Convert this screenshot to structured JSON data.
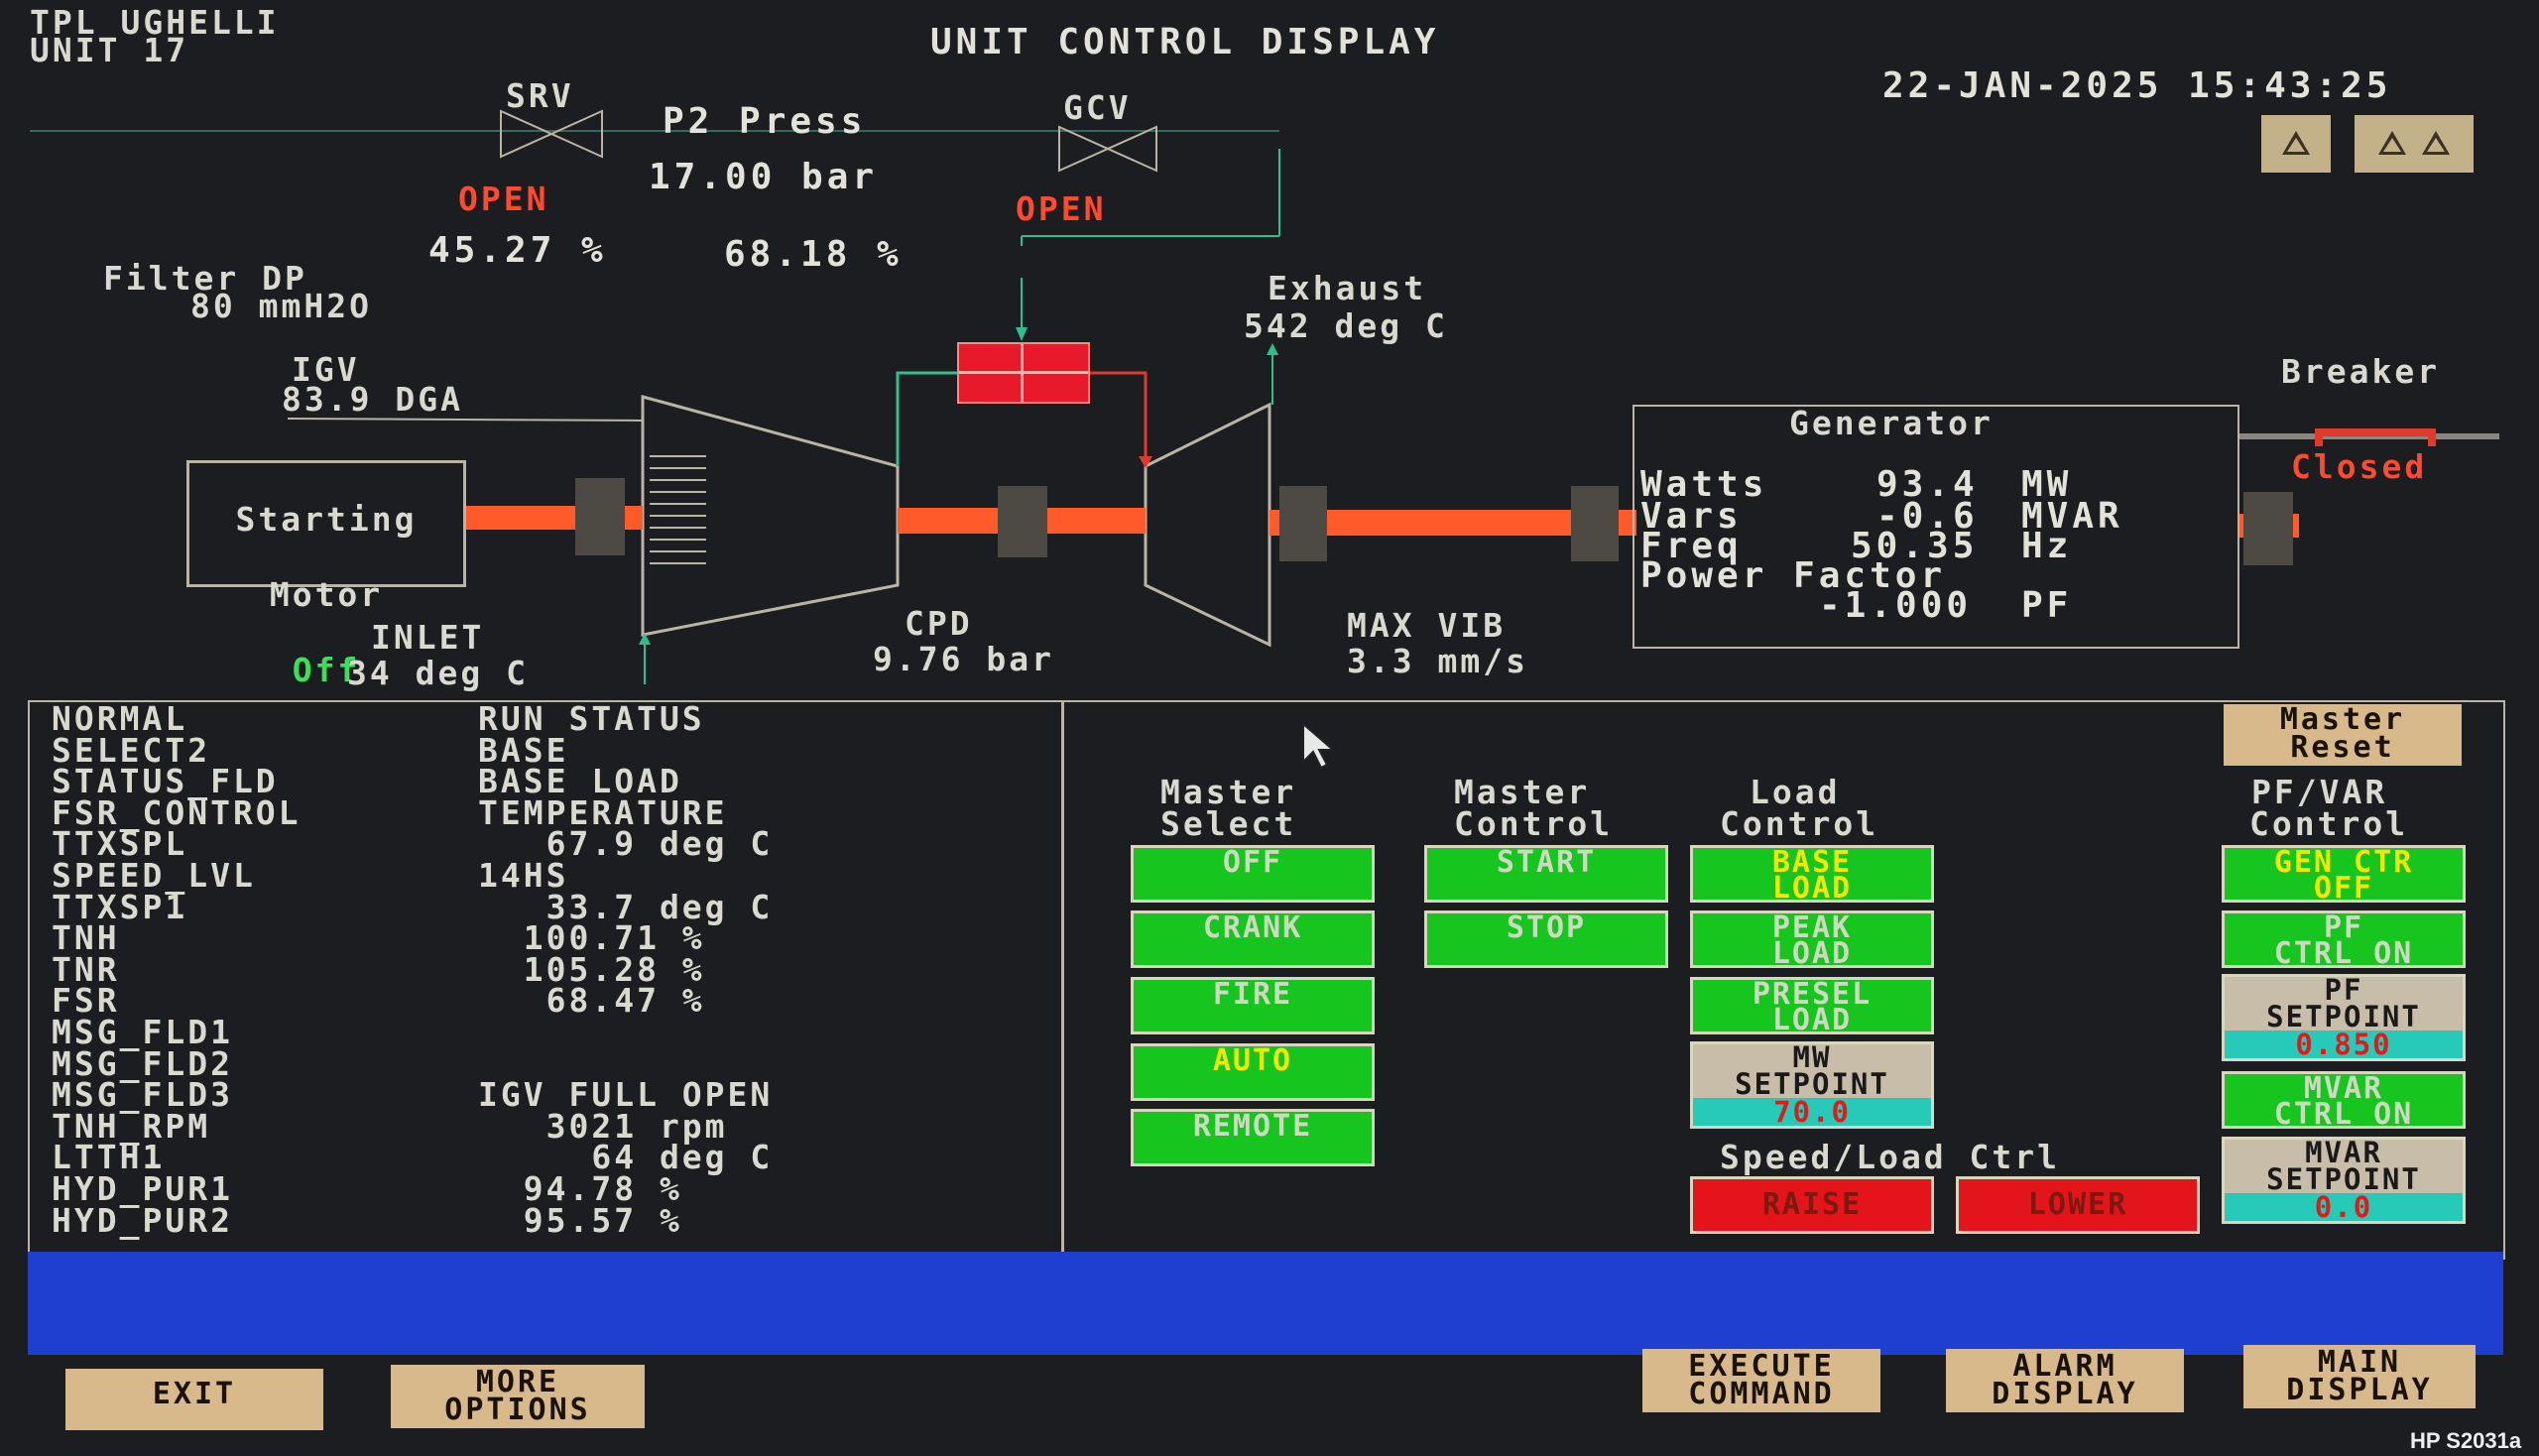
{
  "header": {
    "site": "TPL UGHELLI",
    "unit": "UNIT 17",
    "title": "UNIT CONTROL DISPLAY",
    "datetime": "22-JAN-2025 15:43:25"
  },
  "process": {
    "srv_label": "SRV",
    "srv_state": "OPEN",
    "srv_pct": "45.27 %",
    "p2_label": "P2 Press",
    "p2_value": "17.00 bar",
    "gcv_label": "GCV",
    "gcv_state": "OPEN",
    "gcv_pct": "68.18 %",
    "filter_dp_label": "Filter DP",
    "filter_dp_value": "80 mmH2O",
    "exhaust_label": "Exhaust",
    "exhaust_value": "542 deg C",
    "igv_label": "IGV",
    "igv_value": "83.9 DGA",
    "starting_motor_label_1": "Starting",
    "starting_motor_label_2": "Motor",
    "starting_motor_state": "Off",
    "inlet_label": "INLET",
    "inlet_value": "34 deg C",
    "cpd_label": "CPD",
    "cpd_value": "9.76 bar",
    "max_vib_label": "MAX VIB",
    "max_vib_value": "3.3 mm/s",
    "breaker_label": "Breaker",
    "breaker_state": "Closed"
  },
  "generator": {
    "title": "Generator",
    "watts_label": "Watts",
    "watts_value": "93.4",
    "watts_unit": "MW",
    "vars_label": "Vars",
    "vars_value": "-0.6",
    "vars_unit": "MVAR",
    "freq_label": "Freq",
    "freq_value": "50.35",
    "freq_unit": "Hz",
    "pf_label": "Power Factor",
    "pf_value": "-1.000",
    "pf_unit": "PF"
  },
  "status_rows": [
    {
      "label": "NORMAL",
      "value": "RUN STATUS"
    },
    {
      "label": "SELECT2",
      "value": "BASE"
    },
    {
      "label": "STATUS_FLD",
      "value": "BASE LOAD"
    },
    {
      "label": "FSR_CONTROL",
      "value": "TEMPERATURE"
    },
    {
      "label": "TTXSPL",
      "value": "   67.9 deg C"
    },
    {
      "label": "SPEED_LVL",
      "value": "14HS"
    },
    {
      "label": "TTXSP1",
      "value": "   33.7 deg C"
    },
    {
      "label": "TNH",
      "value": "  100.71 %"
    },
    {
      "label": "TNR",
      "value": "  105.28 %"
    },
    {
      "label": "FSR",
      "value": "   68.47 %"
    },
    {
      "label": "MSG_FLD1",
      "value": ""
    },
    {
      "label": "MSG_FLD2",
      "value": ""
    },
    {
      "label": "MSG_FLD3",
      "value": "IGV FULL OPEN"
    },
    {
      "label": "TNH_RPM",
      "value": "   3021 rpm"
    },
    {
      "label": "LTTH1",
      "value": "     64 deg C"
    },
    {
      "label": "HYD_PUR1",
      "value": "  94.78 %"
    },
    {
      "label": "HYD_PUR2",
      "value": "  95.57 %"
    }
  ],
  "controls": {
    "master_reset_1": "Master",
    "master_reset_2": "Reset",
    "master_select_h1": "Master",
    "master_select_h2": "Select",
    "master_select": [
      "OFF",
      "CRANK",
      "FIRE",
      "AUTO",
      "REMOTE"
    ],
    "master_control_h1": "Master",
    "master_control_h2": "Control",
    "master_control": [
      "START",
      "STOP"
    ],
    "load_control_h1": "Load",
    "load_control_h2": "Control",
    "base_load_1": "BASE",
    "base_load_2": "LOAD",
    "peak_load_1": "PEAK",
    "peak_load_2": "LOAD",
    "presel_load_1": "PRESEL",
    "presel_load_2": "LOAD",
    "mw_setpoint_1": "MW",
    "mw_setpoint_2": "SETPOINT",
    "mw_setpoint_value": "70.0",
    "speed_load_title": "Speed/Load Ctrl",
    "raise": "RAISE",
    "lower": "LOWER",
    "pfvar_h1": "PF/VAR",
    "pfvar_h2": "Control",
    "gen_ctr_1": "GEN CTR",
    "gen_ctr_2": "OFF",
    "pf_ctrl_1": "PF",
    "pf_ctrl_2": "CTRL ON",
    "pf_setpoint_1": "PF",
    "pf_setpoint_2": "SETPOINT",
    "pf_setpoint_value": "0.850",
    "mvar_ctrl_1": "MVAR",
    "mvar_ctrl_2": "CTRL ON",
    "mvar_setpoint_1": "MVAR",
    "mvar_setpoint_2": "SETPOINT",
    "mvar_setpoint_value": "0.0"
  },
  "footer": {
    "exit": "EXIT",
    "more_options_1": "MORE",
    "more_options_2": "OPTIONS",
    "execute_1": "EXECUTE",
    "execute_2": "COMMAND",
    "alarm_1": "ALARM",
    "alarm_2": "DISPLAY",
    "main_1": "MAIN",
    "main_2": "DISPLAY"
  },
  "bezel_label": "HP S2031a",
  "colors": {
    "background": "#1c1d20",
    "shaft": "#ff5a2a",
    "button_green": "#17c51f",
    "button_red": "#e3141a",
    "footer_button": "#d7b98b",
    "message_bar": "#1e3fd0",
    "setpoint_cyan": "#27c9b8"
  }
}
